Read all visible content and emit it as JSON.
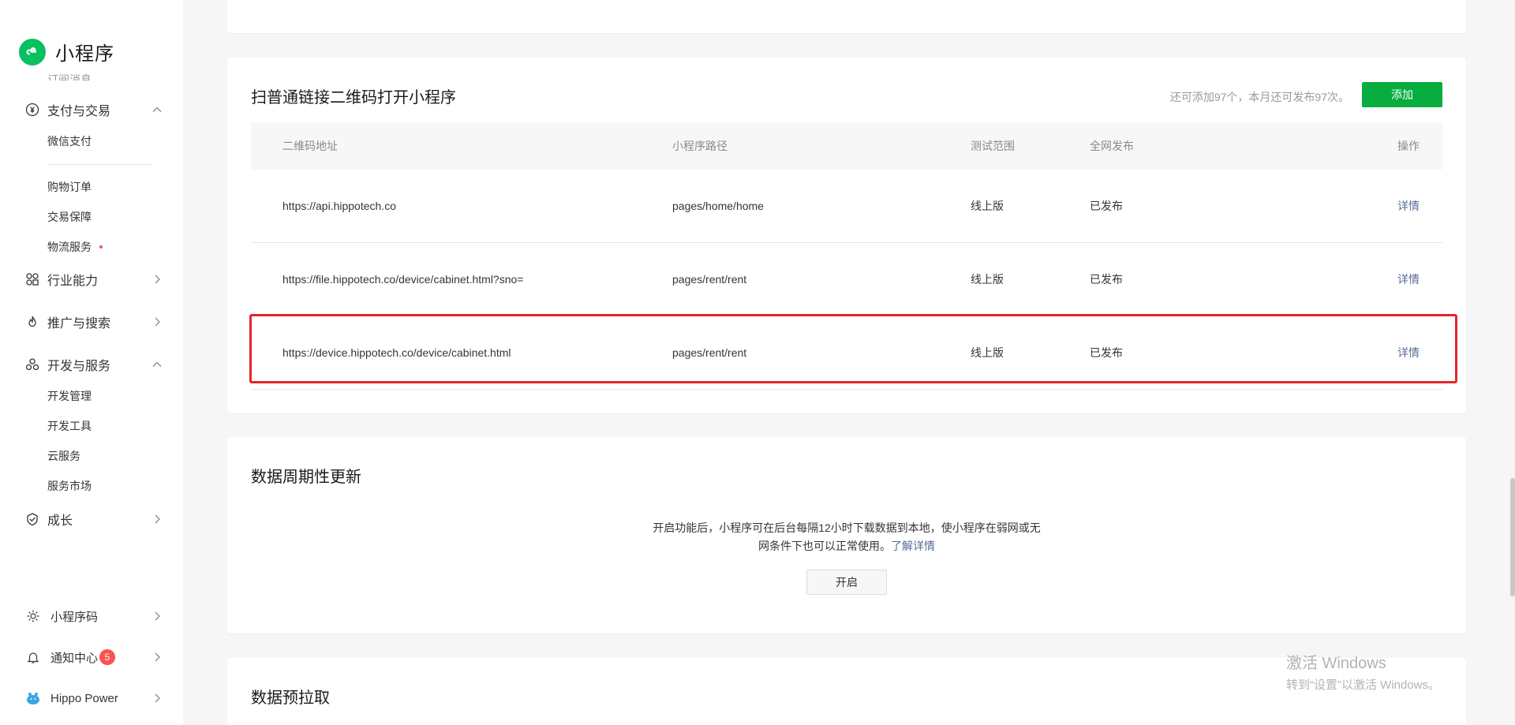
{
  "sidebar": {
    "app_title": "小程序",
    "cut_item": "订阅消息",
    "payment": {
      "label": "支付与交易",
      "items": [
        "微信支付",
        "购物订单",
        "交易保障",
        "物流服务"
      ]
    },
    "industry": {
      "label": "行业能力"
    },
    "promotion": {
      "label": "推广与搜索"
    },
    "dev": {
      "label": "开发与服务",
      "items": [
        "开发管理",
        "开发工具",
        "云服务",
        "服务市场"
      ]
    },
    "growth": {
      "label": "成长"
    },
    "bottom": {
      "qrcode": "小程序码",
      "notify": "通知中心",
      "notify_count": "5",
      "account": "Hippo Power"
    }
  },
  "qr_section": {
    "title": "扫普通链接二维码打开小程序",
    "hint": "还可添加97个，本月还可发布97次。",
    "add_label": "添加",
    "columns": [
      "二维码地址",
      "小程序路径",
      "测试范围",
      "全网发布",
      "操作"
    ],
    "rows": [
      {
        "url": "https://api.hippotech.co",
        "path": "pages/home/home",
        "scope": "线上版",
        "publish": "已发布",
        "action": "详情"
      },
      {
        "url": "https://file.hippotech.co/device/cabinet.html?sno=",
        "path": "pages/rent/rent",
        "scope": "线上版",
        "publish": "已发布",
        "action": "详情"
      },
      {
        "url": "https://device.hippotech.co/device/cabinet.html",
        "path": "pages/rent/rent",
        "scope": "线上版",
        "publish": "已发布",
        "action": "详情"
      }
    ]
  },
  "periodic_section": {
    "title": "数据周期性更新",
    "desc_line1": "开启功能后，小程序可在后台每隔12小时下载数据到本地，使小程序在弱网或无",
    "desc_line2": "网条件下也可以正常使用。",
    "learn_more": "了解详情",
    "open_label": "开启"
  },
  "prefetch_section": {
    "title": "数据预拉取"
  },
  "watermark": {
    "line1": "激活 Windows",
    "line2": "转到“设置”以激活 Windows。"
  },
  "colors": {
    "brand_green": "#07c160",
    "button_green": "#07ad3e",
    "link": "#576b95",
    "highlight_red": "#e4262a",
    "badge_red": "#fa5151"
  }
}
